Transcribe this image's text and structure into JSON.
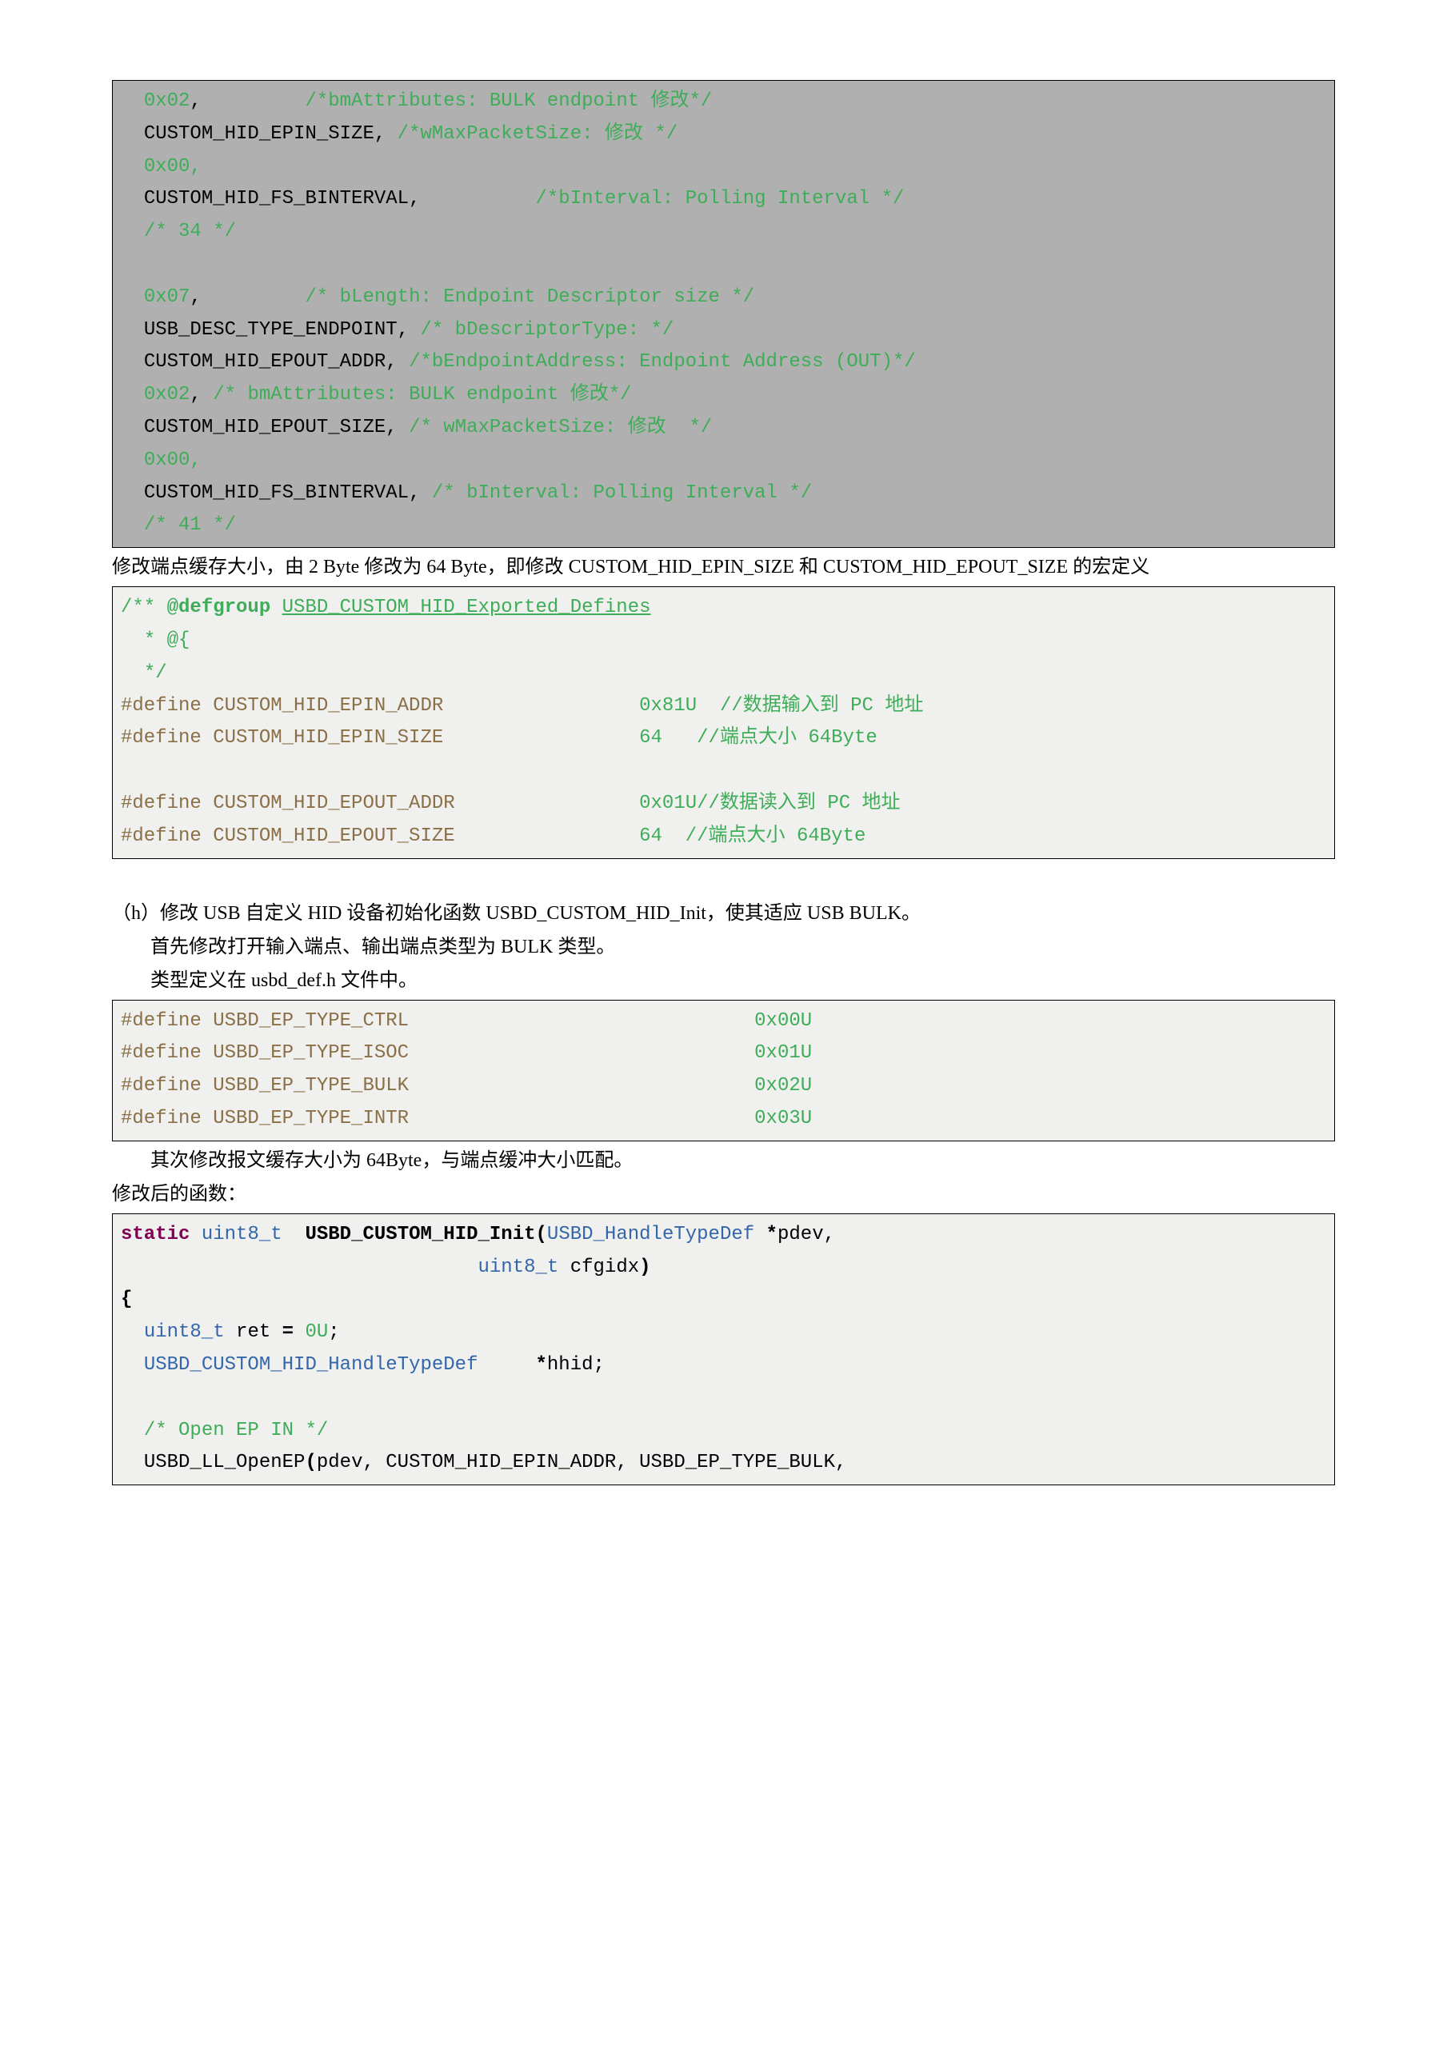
{
  "codeblock_a": {
    "style": "hilite",
    "lines": [
      [
        {
          "t": "  ",
          "c": "#000"
        },
        {
          "t": "0x02",
          "c": "#3ead58"
        },
        {
          "t": ",         ",
          "c": "#000"
        },
        {
          "t": "/*bmAttributes: BULK endpoint 修改*/",
          "c": "#3ead58"
        }
      ],
      [
        {
          "t": "  CUSTOM_HID_EPIN_SIZE, ",
          "c": "#000"
        },
        {
          "t": "/*wMaxPacketSize: 修改 */",
          "c": "#3ead58"
        }
      ],
      [
        {
          "t": "  ",
          "c": "#000"
        },
        {
          "t": "0x00",
          "c": "#3ead58"
        },
        {
          "t": ",",
          "c": "#3ead58"
        }
      ],
      [
        {
          "t": "  CUSTOM_HID_FS_BINTERVAL,          ",
          "c": "#000"
        },
        {
          "t": "/*bInterval: Polling Interval */",
          "c": "#3ead58"
        }
      ],
      [
        {
          "t": "  ",
          "c": "#000"
        },
        {
          "t": "/* 34 */",
          "c": "#3ead58"
        }
      ],
      [
        {
          "t": " ",
          "c": "#000"
        }
      ],
      [
        {
          "t": "  ",
          "c": "#000"
        },
        {
          "t": "0x07",
          "c": "#3ead58"
        },
        {
          "t": ",         ",
          "c": "#000"
        },
        {
          "t": "/* bLength: Endpoint Descriptor size */",
          "c": "#3ead58"
        }
      ],
      [
        {
          "t": "  USB_DESC_TYPE_ENDPOINT, ",
          "c": "#000"
        },
        {
          "t": "/* bDescriptorType: */",
          "c": "#3ead58"
        }
      ],
      [
        {
          "t": "  CUSTOM_HID_EPOUT_ADDR, ",
          "c": "#000"
        },
        {
          "t": "/*bEndpointAddress: Endpoint Address (OUT)*/",
          "c": "#3ead58"
        }
      ],
      [
        {
          "t": "  ",
          "c": "#000"
        },
        {
          "t": "0x02",
          "c": "#3ead58"
        },
        {
          "t": ", ",
          "c": "#000"
        },
        {
          "t": "/* bmAttributes: BULK endpoint 修改*/",
          "c": "#3ead58"
        }
      ],
      [
        {
          "t": "  CUSTOM_HID_EPOUT_SIZE, ",
          "c": "#000"
        },
        {
          "t": "/* wMaxPacketSize: 修改  */",
          "c": "#3ead58"
        }
      ],
      [
        {
          "t": "  ",
          "c": "#000"
        },
        {
          "t": "0x00",
          "c": "#3ead58"
        },
        {
          "t": ",",
          "c": "#3ead58"
        }
      ],
      [
        {
          "t": "  CUSTOM_HID_FS_BINTERVAL, ",
          "c": "#000"
        },
        {
          "t": "/* bInterval: Polling Interval */",
          "c": "#3ead58"
        }
      ],
      [
        {
          "t": "  ",
          "c": "#000"
        },
        {
          "t": "/* 41 */",
          "c": "#3ead58"
        }
      ]
    ]
  },
  "para1": "修改端点缓存大小，由 2 Byte 修改为 64 Byte，即修改 CUSTOM_HID_EPIN_SIZE 和 CUSTOM_HID_EPOUT_SIZE 的宏定义",
  "codeblock_b": {
    "style": "light",
    "lines": [
      [
        {
          "t": "/** ",
          "c": "#3ead58"
        },
        {
          "t": "@defgroup",
          "c": "#3ead58",
          "b": true
        },
        {
          "t": " ",
          "c": "#3ead58"
        },
        {
          "t": "USBD_CUSTOM_HID_Exported_Defines",
          "c": "#3ead58",
          "u": true
        }
      ],
      [
        {
          "t": "  * @{",
          "c": "#3ead58"
        }
      ],
      [
        {
          "t": "  */",
          "c": "#3ead58"
        }
      ],
      [
        {
          "t": "#define CUSTOM_HID_EPIN_ADDR                 ",
          "c": "#8b6f47"
        },
        {
          "t": "0x81U",
          "c": "#3ead58"
        },
        {
          "t": "  ",
          "c": "#8b6f47"
        },
        {
          "t": "//数据输入到 PC 地址",
          "c": "#3ead58"
        }
      ],
      [
        {
          "t": "#define CUSTOM_HID_EPIN_SIZE                 ",
          "c": "#8b6f47"
        },
        {
          "t": "64",
          "c": "#3ead58"
        },
        {
          "t": "   ",
          "c": "#8b6f47"
        },
        {
          "t": "//端点大小 64Byte",
          "c": "#3ead58"
        }
      ],
      [
        {
          "t": " ",
          "c": "#000"
        }
      ],
      [
        {
          "t": "#define CUSTOM_HID_EPOUT_ADDR                ",
          "c": "#8b6f47"
        },
        {
          "t": "0x01U",
          "c": "#3ead58"
        },
        {
          "t": "//数据读入到 PC 地址",
          "c": "#3ead58"
        }
      ],
      [
        {
          "t": "#define CUSTOM_HID_EPOUT_SIZE                ",
          "c": "#8b6f47"
        },
        {
          "t": "64",
          "c": "#3ead58"
        },
        {
          "t": "  ",
          "c": "#8b6f47"
        },
        {
          "t": "//端点大小 64Byte",
          "c": "#3ead58"
        }
      ]
    ]
  },
  "para2a": "（h）修改 USB 自定义 HID 设备初始化函数 USBD_CUSTOM_HID_Init，使其适应 USB BULK。",
  "para2b": "首先修改打开输入端点、输出端点类型为 BULK 类型。",
  "para2c": "类型定义在 usbd_def.h 文件中。",
  "codeblock_c": {
    "style": "light",
    "lines": [
      [
        {
          "t": "#define USBD_EP_TYPE_CTRL                              ",
          "c": "#8b6f47"
        },
        {
          "t": "0x00U",
          "c": "#3ead58"
        }
      ],
      [
        {
          "t": "#define USBD_EP_TYPE_ISOC                              ",
          "c": "#8b6f47"
        },
        {
          "t": "0x01U",
          "c": "#3ead58"
        }
      ],
      [
        {
          "t": "#define USBD_EP_TYPE_BULK                              ",
          "c": "#8b6f47"
        },
        {
          "t": "0x02U",
          "c": "#3ead58"
        }
      ],
      [
        {
          "t": "#define USBD_EP_TYPE_INTR                              ",
          "c": "#8b6f47"
        },
        {
          "t": "0x03U",
          "c": "#3ead58"
        }
      ]
    ]
  },
  "para3": "其次修改报文缓存大小为 64Byte，与端点缓冲大小匹配。",
  "para4": "修改后的函数：",
  "codeblock_d": {
    "style": "light",
    "lines": [
      [
        {
          "t": "static",
          "c": "#7f0055",
          "b": true
        },
        {
          "t": " ",
          "c": "#000"
        },
        {
          "t": "uint8_t",
          "c": "#3366aa"
        },
        {
          "t": "  ",
          "c": "#000"
        },
        {
          "t": "USBD_CUSTOM_HID_Init",
          "c": "#000",
          "b": true
        },
        {
          "t": "(",
          "c": "#000",
          "b": true
        },
        {
          "t": "USBD_HandleTypeDef",
          "c": "#3366aa"
        },
        {
          "t": " ",
          "c": "#000"
        },
        {
          "t": "*",
          "c": "#000",
          "b": true
        },
        {
          "t": "pdev,",
          "c": "#000"
        }
      ],
      [
        {
          "t": "                               ",
          "c": "#000"
        },
        {
          "t": "uint8_t",
          "c": "#3366aa"
        },
        {
          "t": " cfgidx",
          "c": "#000"
        },
        {
          "t": ")",
          "c": "#000",
          "b": true
        }
      ],
      [
        {
          "t": "{",
          "c": "#000",
          "b": true
        }
      ],
      [
        {
          "t": "  ",
          "c": "#000"
        },
        {
          "t": "uint8_t",
          "c": "#3366aa"
        },
        {
          "t": " ret ",
          "c": "#000"
        },
        {
          "t": "=",
          "c": "#000",
          "b": true
        },
        {
          "t": " ",
          "c": "#000"
        },
        {
          "t": "0U",
          "c": "#3ead58"
        },
        {
          "t": ";",
          "c": "#000"
        }
      ],
      [
        {
          "t": "  ",
          "c": "#000"
        },
        {
          "t": "USBD_CUSTOM_HID_HandleTypeDef",
          "c": "#3366aa"
        },
        {
          "t": "     ",
          "c": "#000"
        },
        {
          "t": "*",
          "c": "#000",
          "b": true
        },
        {
          "t": "hhid;",
          "c": "#000"
        }
      ],
      [
        {
          "t": " ",
          "c": "#000"
        }
      ],
      [
        {
          "t": "  ",
          "c": "#000"
        },
        {
          "t": "/* Open EP IN */",
          "c": "#3ead58"
        }
      ],
      [
        {
          "t": "  USBD_LL_OpenEP",
          "c": "#000"
        },
        {
          "t": "(",
          "c": "#000",
          "b": true
        },
        {
          "t": "pdev, CUSTOM_HID_EPIN_ADDR, USBD_EP_TYPE_BULK,",
          "c": "#000"
        }
      ]
    ]
  }
}
